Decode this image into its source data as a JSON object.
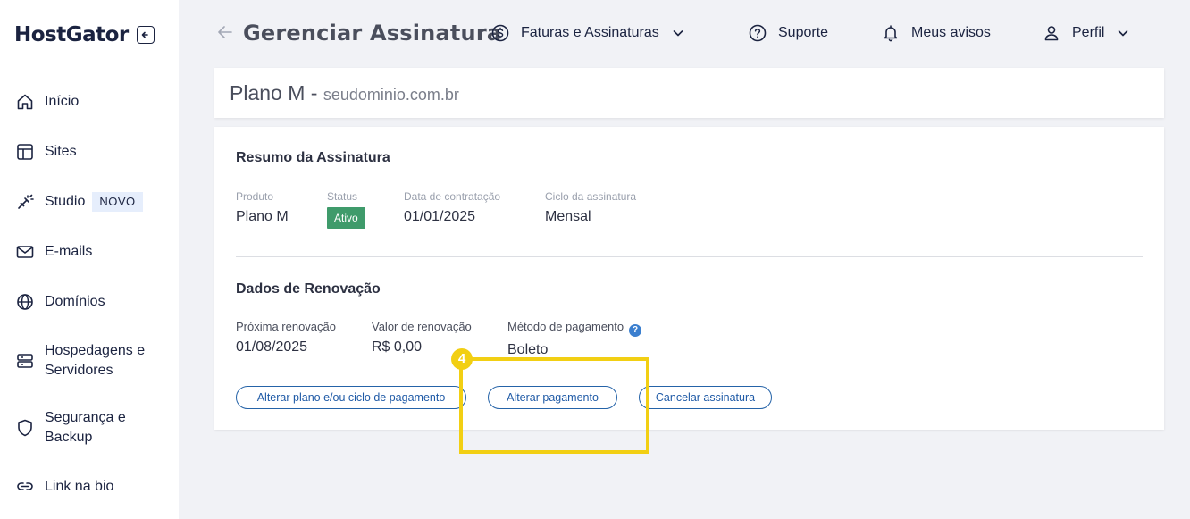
{
  "sidebar": {
    "logo": "HostGator",
    "items": [
      {
        "label": "Início",
        "icon": "home-icon"
      },
      {
        "label": "Sites",
        "icon": "layout-icon"
      },
      {
        "label": "Studio",
        "icon": "magic-wand-icon",
        "badge": "NOVO"
      },
      {
        "label": "E-mails",
        "icon": "mail-icon"
      },
      {
        "label": "Domínios",
        "icon": "globe-icon"
      },
      {
        "label": "Hospedagens e Servidores",
        "icon": "server-icon"
      },
      {
        "label": "Segurança e Backup",
        "icon": "shield-icon"
      },
      {
        "label": "Link na bio",
        "icon": "link-icon"
      }
    ]
  },
  "header": {
    "title": "Gerenciar Assinatura",
    "nav": [
      {
        "label": "Faturas e Assinaturas",
        "icon": "dollar-circle-icon",
        "dropdown": true
      },
      {
        "label": "Suporte",
        "icon": "help-circle-icon"
      },
      {
        "label": "Meus avisos",
        "icon": "bell-icon"
      },
      {
        "label": "Perfil",
        "icon": "user-icon",
        "dropdown": true
      }
    ]
  },
  "plan": {
    "name": "Plano M",
    "separator": " - ",
    "domain": "seudominio.com.br"
  },
  "summary": {
    "title": "Resumo da Assinatura",
    "fields": {
      "product_label": "Produto",
      "product_value": "Plano M",
      "status_label": "Status",
      "status_value": "Ativo",
      "contract_label": "Data de contratação",
      "contract_value": "01/01/2025",
      "cycle_label": "Ciclo da assinatura",
      "cycle_value": "Mensal"
    }
  },
  "renewal": {
    "title": "Dados de Renovação",
    "fields": {
      "next_label": "Próxima renovação",
      "next_value": "01/08/2025",
      "amount_label": "Valor de renovação",
      "amount_value": "R$ 0,00",
      "method_label": "Método de pagamento",
      "method_help": "?",
      "method_value": "Boleto"
    }
  },
  "actions": {
    "change_plan": "Alterar plano e/ou ciclo de pagamento",
    "change_payment": "Alterar pagamento",
    "cancel": "Cancelar assinatura"
  },
  "annotation": {
    "step": "4"
  },
  "colors": {
    "highlight": "#f2cf13",
    "status_active": "#3f9b6b",
    "button_border": "#2563a8",
    "brand_dark": "#1b2340"
  }
}
